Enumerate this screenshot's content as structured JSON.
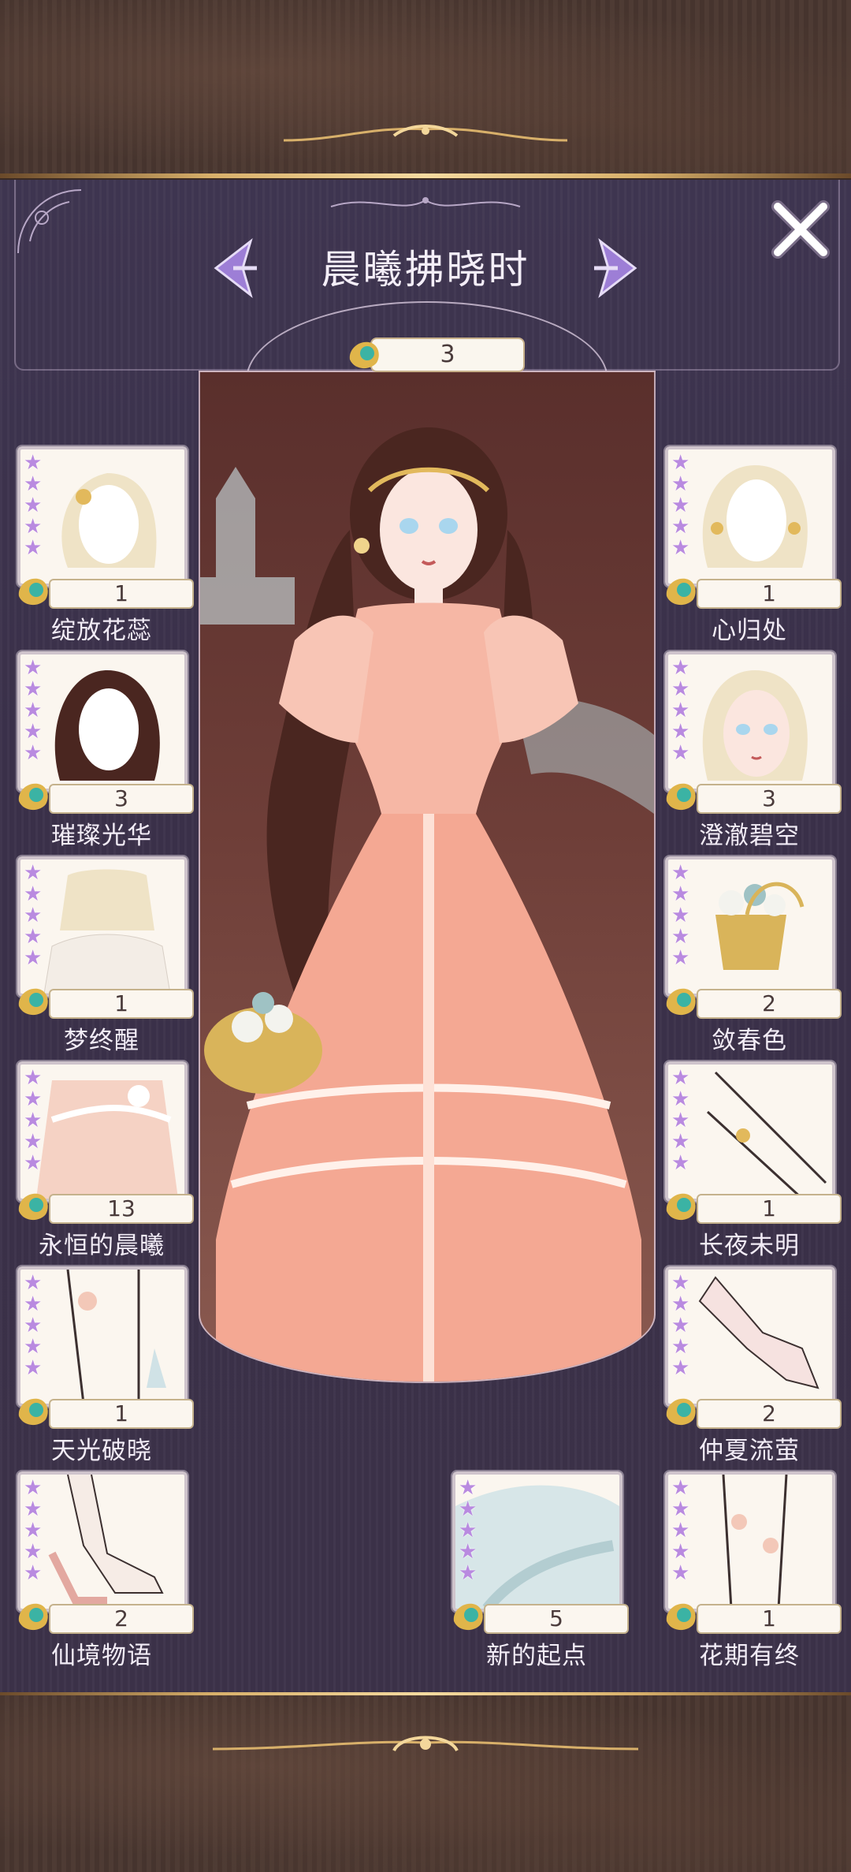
{
  "suit_title": "晨曦拂晓时",
  "suit_count": "3",
  "colors": {
    "accent_purple": "#b98ae0",
    "gold": "#d8b06a",
    "panel": "#3b3148"
  },
  "left_items": [
    {
      "name": "绽放花蕊",
      "qty": "1",
      "icon": "hair-accessory-icon"
    },
    {
      "name": "璀璨光华",
      "qty": "3",
      "icon": "hair-icon"
    },
    {
      "name": "梦终醒",
      "qty": "1",
      "icon": "coat-icon"
    },
    {
      "name": "永恒的晨曦",
      "qty": "13",
      "icon": "dress-icon"
    },
    {
      "name": "天光破晓",
      "qty": "1",
      "icon": "stockings-icon"
    },
    {
      "name": "仙境物语",
      "qty": "2",
      "icon": "shoes-icon"
    }
  ],
  "right_items": [
    {
      "name": "心归处",
      "qty": "1",
      "icon": "earrings-icon"
    },
    {
      "name": "澄澈碧空",
      "qty": "3",
      "icon": "makeup-icon"
    },
    {
      "name": "敛春色",
      "qty": "2",
      "icon": "flower-basket-icon"
    },
    {
      "name": "长夜未明",
      "qty": "1",
      "icon": "bracelet-icon"
    },
    {
      "name": "仲夏流萤",
      "qty": "2",
      "icon": "gloves-icon"
    },
    {
      "name": "花期有终",
      "qty": "1",
      "icon": "anklet-icon"
    }
  ],
  "center_item": {
    "name": "新的起点",
    "qty": "5",
    "icon": "background-staircase-icon"
  },
  "star_rating": 5
}
